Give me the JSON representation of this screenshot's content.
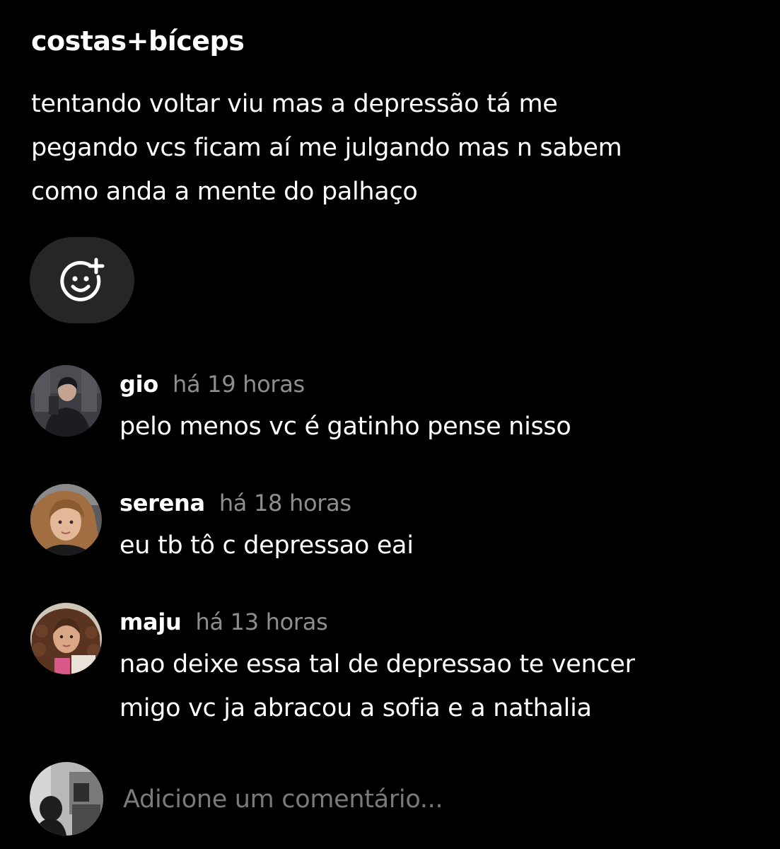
{
  "post": {
    "title": "costas+bíceps",
    "body_lines": [
      "tentando voltar viu mas a depressão tá me",
      "pegando vcs ficam aí me julgando mas n sabem",
      "como anda a mente do palhaço"
    ]
  },
  "reaction_button": {
    "icon": "add-reaction-icon"
  },
  "comments": [
    {
      "username": "gio",
      "time": "há 19 horas",
      "lines": [
        "pelo menos vc é gatinho pense nisso"
      ]
    },
    {
      "username": "serena",
      "time": "há 18 horas",
      "lines": [
        "eu tb tô c depressao eai"
      ]
    },
    {
      "username": "maju",
      "time": "há 13 horas",
      "lines": [
        "nao deixe essa tal de depressao te vencer",
        "migo vc ja abracou a sofia e a nathalia"
      ]
    }
  ],
  "add_comment": {
    "placeholder": "Adicione um comentário..."
  },
  "colors": {
    "background": "#000000",
    "text": "#ffffff",
    "muted": "#8e8e8e",
    "button_bg": "#262626"
  }
}
